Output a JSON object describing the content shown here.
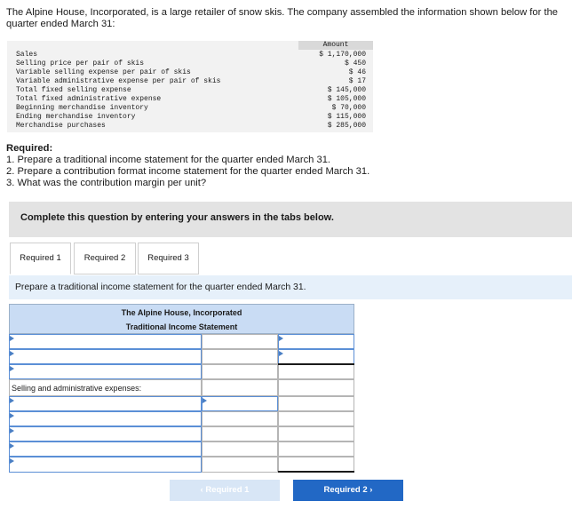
{
  "intro": "The Alpine House, Incorporated, is a large retailer of snow skis. The company assembled the information shown below for the quarter ended March 31:",
  "given": {
    "header": "Amount",
    "rows": [
      {
        "label": "Sales",
        "amount": "$ 1,170,000"
      },
      {
        "label": "Selling price per pair of skis",
        "amount": "$ 450"
      },
      {
        "label": "Variable selling expense per pair of skis",
        "amount": "$ 46"
      },
      {
        "label": "Variable administrative expense per pair of skis",
        "amount": "$ 17"
      },
      {
        "label": "Total fixed selling expense",
        "amount": "$ 145,000"
      },
      {
        "label": "Total fixed administrative expense",
        "amount": "$ 105,000"
      },
      {
        "label": "Beginning merchandise inventory",
        "amount": "$ 70,000"
      },
      {
        "label": "Ending merchandise inventory",
        "amount": "$ 115,000"
      },
      {
        "label": "Merchandise purchases",
        "amount": "$ 285,000"
      }
    ]
  },
  "required": {
    "title": "Required:",
    "items": [
      "1. Prepare a traditional income statement for the quarter ended March 31.",
      "2. Prepare a contribution format income statement for the quarter ended March 31.",
      "3. What was the contribution margin per unit?"
    ]
  },
  "banner": "Complete this question by entering your answers in the tabs below.",
  "tabs": [
    {
      "label": "Required 1",
      "active": true
    },
    {
      "label": "Required 2",
      "active": false
    },
    {
      "label": "Required 3",
      "active": false
    }
  ],
  "prompt": "Prepare a traditional income statement for the quarter ended March 31.",
  "statement": {
    "company": "The Alpine House, Incorporated",
    "title": "Traditional Income Statement",
    "section_label": "Selling and administrative expenses:"
  },
  "nav": {
    "prev_label": "Required 1",
    "next_label": "Required 2",
    "prev_icon": "chevron-left-icon",
    "next_icon": "chevron-right-icon"
  },
  "colors": {
    "accent": "#2268c5",
    "header_fill": "#c9dcf4",
    "prompt_fill": "#e6f0fa",
    "banner_fill": "#e3e3e3"
  }
}
